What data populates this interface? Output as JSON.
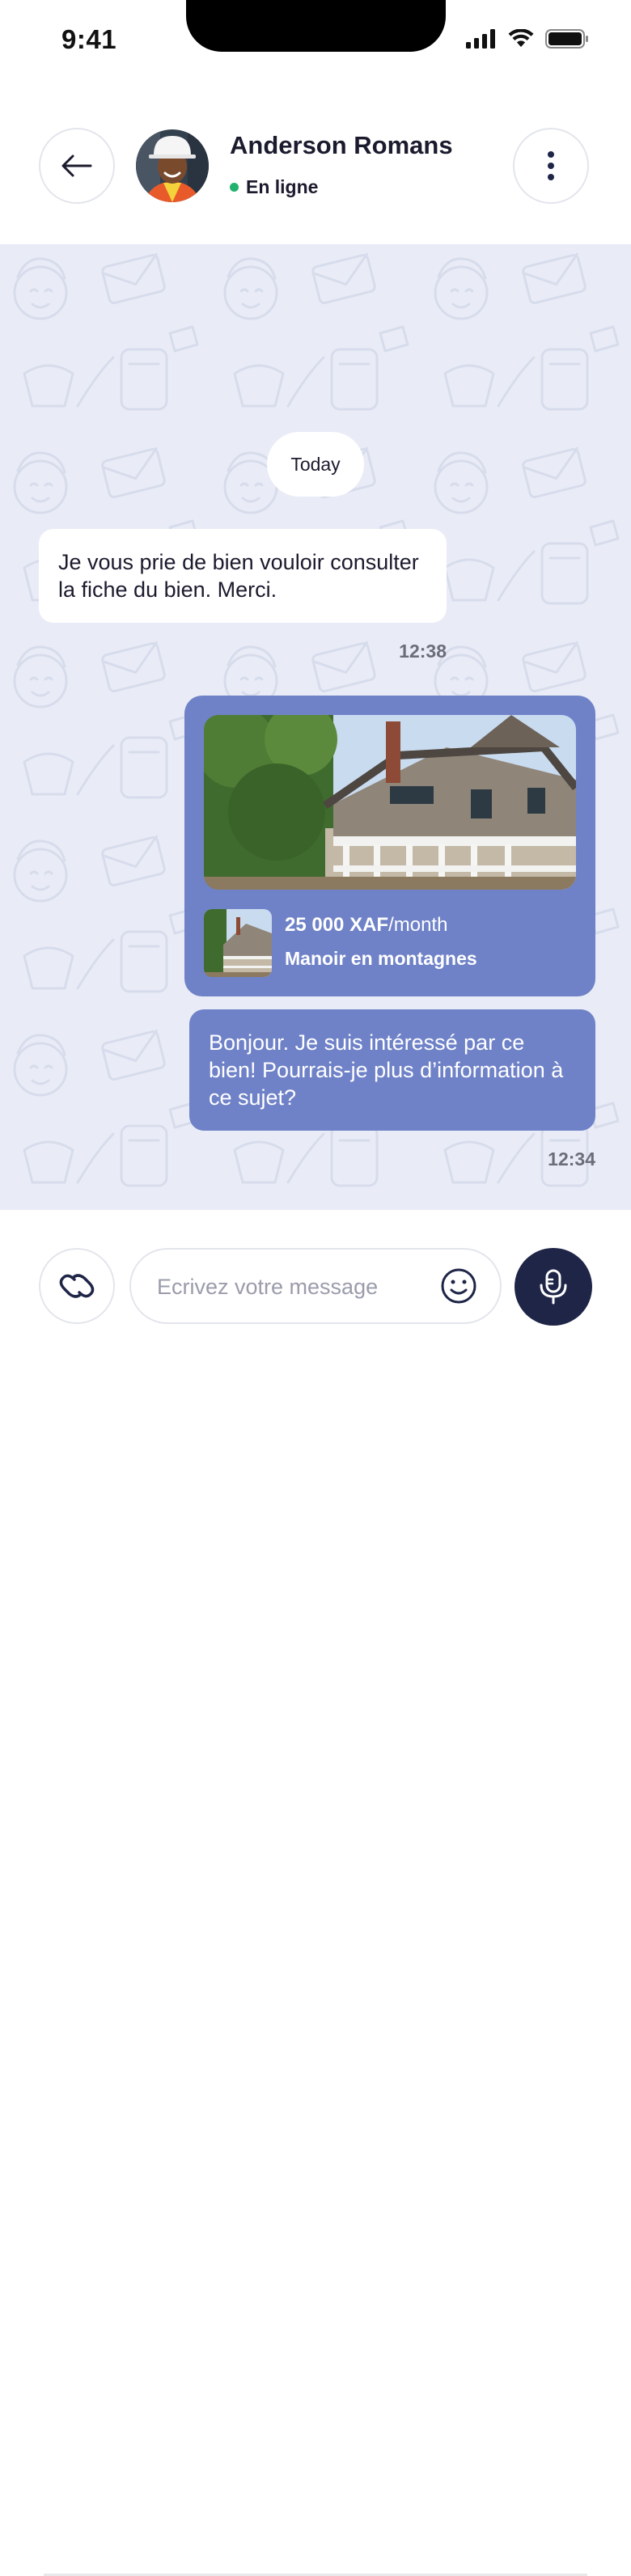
{
  "status_bar": {
    "time": "9:41",
    "icons": [
      "signal-icon",
      "wifi-icon",
      "battery-icon"
    ]
  },
  "header": {
    "back_icon": "arrow-left-icon",
    "contact_name": "Anderson Romans",
    "status_text": "En ligne",
    "status_color": "#23b26d",
    "more_icon": "vertical-dots-icon"
  },
  "chat": {
    "date_label": "Today",
    "messages": [
      {
        "direction": "incoming",
        "text": "Je vous prie de bien vouloir consulter la fiche du bien. Merci.",
        "time": "12:38"
      },
      {
        "direction": "outgoing",
        "type": "listing-card",
        "price": "25 000 XAF",
        "price_suffix": "/month",
        "title": "Manoir en montagnes"
      },
      {
        "direction": "outgoing",
        "text": "Bonjour. Je suis intéressé par ce bien! Pourrais-je plus d’information à ce sujet?",
        "time": "12:34"
      }
    ]
  },
  "composer": {
    "attach_icon": "link-icon",
    "placeholder": "Ecrivez votre message",
    "emoji_icon": "smiley-icon",
    "mic_icon": "microphone-icon"
  },
  "colors": {
    "accent_bubble": "#6f82c8",
    "chat_background": "#e9ecf6",
    "mic_button": "#1e2547"
  }
}
